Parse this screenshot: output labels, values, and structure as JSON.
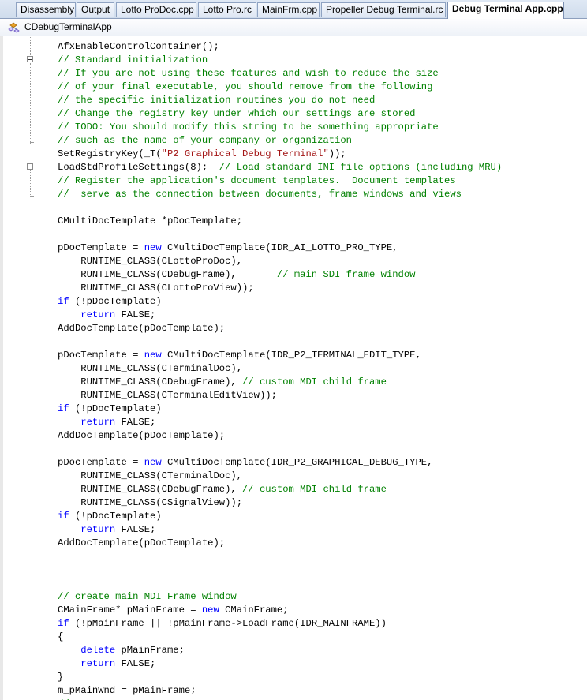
{
  "tabs": [
    {
      "label": "Disassembly",
      "active": false
    },
    {
      "label": "Output",
      "active": false
    },
    {
      "label": "Lotto ProDoc.cpp",
      "active": false
    },
    {
      "label": "Lotto Pro.rc",
      "active": false
    },
    {
      "label": "MainFrm.cpp",
      "active": false
    },
    {
      "label": "Propeller Debug Terminal.rc",
      "active": false
    },
    {
      "label": "Debug Terminal App.cpp",
      "active": true
    }
  ],
  "navbar": {
    "class_name": "CDebugTerminalApp",
    "icon": "class-icon"
  },
  "colors": {
    "keyword": "#0000ff",
    "comment": "#008000",
    "string": "#a31515",
    "text": "#000000",
    "tab_bar": "#cfdcec"
  },
  "code": {
    "lines": [
      [
        [
          "t",
          "AfxEnableControlContainer();"
        ]
      ],
      [
        [
          "c",
          "// Standard initialization"
        ]
      ],
      [
        [
          "c",
          "// If you are not using these features and wish to reduce the size"
        ]
      ],
      [
        [
          "c",
          "// of your final executable, you should remove from the following"
        ]
      ],
      [
        [
          "c",
          "// the specific initialization routines you do not need"
        ]
      ],
      [
        [
          "c",
          "// Change the registry key under which our settings are stored"
        ]
      ],
      [
        [
          "c",
          "// TODO: You should modify this string to be something appropriate"
        ]
      ],
      [
        [
          "c",
          "// such as the name of your company or organization"
        ]
      ],
      [
        [
          "t",
          "SetRegistryKey(_T("
        ],
        [
          "s",
          "\"P2 Graphical Debug Terminal\""
        ],
        [
          "t",
          "));"
        ]
      ],
      [
        [
          "t",
          "LoadStdProfileSettings(8);  "
        ],
        [
          "c",
          "// Load standard INI file options (including MRU)"
        ]
      ],
      [
        [
          "c",
          "// Register the application's document templates.  Document templates"
        ]
      ],
      [
        [
          "c",
          "//  serve as the connection between documents, frame windows and views"
        ]
      ],
      [],
      [
        [
          "t",
          "CMultiDocTemplate *pDocTemplate;"
        ]
      ],
      [],
      [
        [
          "t",
          "pDocTemplate = "
        ],
        [
          "k",
          "new"
        ],
        [
          "t",
          " CMultiDocTemplate(IDR_AI_LOTTO_PRO_TYPE,"
        ]
      ],
      [
        [
          "t",
          "    RUNTIME_CLASS(CLottoProDoc),"
        ]
      ],
      [
        [
          "t",
          "    RUNTIME_CLASS(CDebugFrame),       "
        ],
        [
          "c",
          "// main SDI frame window"
        ]
      ],
      [
        [
          "t",
          "    RUNTIME_CLASS(CLottoProView));"
        ]
      ],
      [
        [
          "k",
          "if"
        ],
        [
          "t",
          " (!pDocTemplate)"
        ]
      ],
      [
        [
          "t",
          "    "
        ],
        [
          "k",
          "return"
        ],
        [
          "t",
          " FALSE;"
        ]
      ],
      [
        [
          "t",
          "AddDocTemplate(pDocTemplate);"
        ]
      ],
      [],
      [
        [
          "t",
          "pDocTemplate = "
        ],
        [
          "k",
          "new"
        ],
        [
          "t",
          " CMultiDocTemplate(IDR_P2_TERMINAL_EDIT_TYPE,"
        ]
      ],
      [
        [
          "t",
          "    RUNTIME_CLASS(CTerminalDoc),"
        ]
      ],
      [
        [
          "t",
          "    RUNTIME_CLASS(CDebugFrame), "
        ],
        [
          "c",
          "// custom MDI child frame"
        ]
      ],
      [
        [
          "t",
          "    RUNTIME_CLASS(CTerminalEditView));"
        ]
      ],
      [
        [
          "k",
          "if"
        ],
        [
          "t",
          " (!pDocTemplate)"
        ]
      ],
      [
        [
          "t",
          "    "
        ],
        [
          "k",
          "return"
        ],
        [
          "t",
          " FALSE;"
        ]
      ],
      [
        [
          "t",
          "AddDocTemplate(pDocTemplate);"
        ]
      ],
      [],
      [
        [
          "t",
          "pDocTemplate = "
        ],
        [
          "k",
          "new"
        ],
        [
          "t",
          " CMultiDocTemplate(IDR_P2_GRAPHICAL_DEBUG_TYPE,"
        ]
      ],
      [
        [
          "t",
          "    RUNTIME_CLASS(CTerminalDoc),"
        ]
      ],
      [
        [
          "t",
          "    RUNTIME_CLASS(CDebugFrame), "
        ],
        [
          "c",
          "// custom MDI child frame"
        ]
      ],
      [
        [
          "t",
          "    RUNTIME_CLASS(CSignalView));"
        ]
      ],
      [
        [
          "k",
          "if"
        ],
        [
          "t",
          " (!pDocTemplate)"
        ]
      ],
      [
        [
          "t",
          "    "
        ],
        [
          "k",
          "return"
        ],
        [
          "t",
          " FALSE;"
        ]
      ],
      [
        [
          "t",
          "AddDocTemplate(pDocTemplate);"
        ]
      ],
      [],
      [],
      [],
      [
        [
          "c",
          "// create main MDI Frame window"
        ]
      ],
      [
        [
          "t",
          "CMainFrame* pMainFrame = "
        ],
        [
          "k",
          "new"
        ],
        [
          "t",
          " CMainFrame;"
        ]
      ],
      [
        [
          "k",
          "if"
        ],
        [
          "t",
          " (!pMainFrame || !pMainFrame->LoadFrame(IDR_MAINFRAME))"
        ]
      ],
      [
        [
          "t",
          "{"
        ]
      ],
      [
        [
          "t",
          "    "
        ],
        [
          "k",
          "delete"
        ],
        [
          "t",
          " pMainFrame;"
        ]
      ],
      [
        [
          "t",
          "    "
        ],
        [
          "k",
          "return"
        ],
        [
          "t",
          " FALSE;"
        ]
      ],
      [
        [
          "t",
          "}"
        ]
      ],
      [
        [
          "t",
          "m_pMainWnd = pMainFrame;"
        ]
      ],
      [
        [
          "c",
          "// ..."
        ]
      ]
    ]
  }
}
